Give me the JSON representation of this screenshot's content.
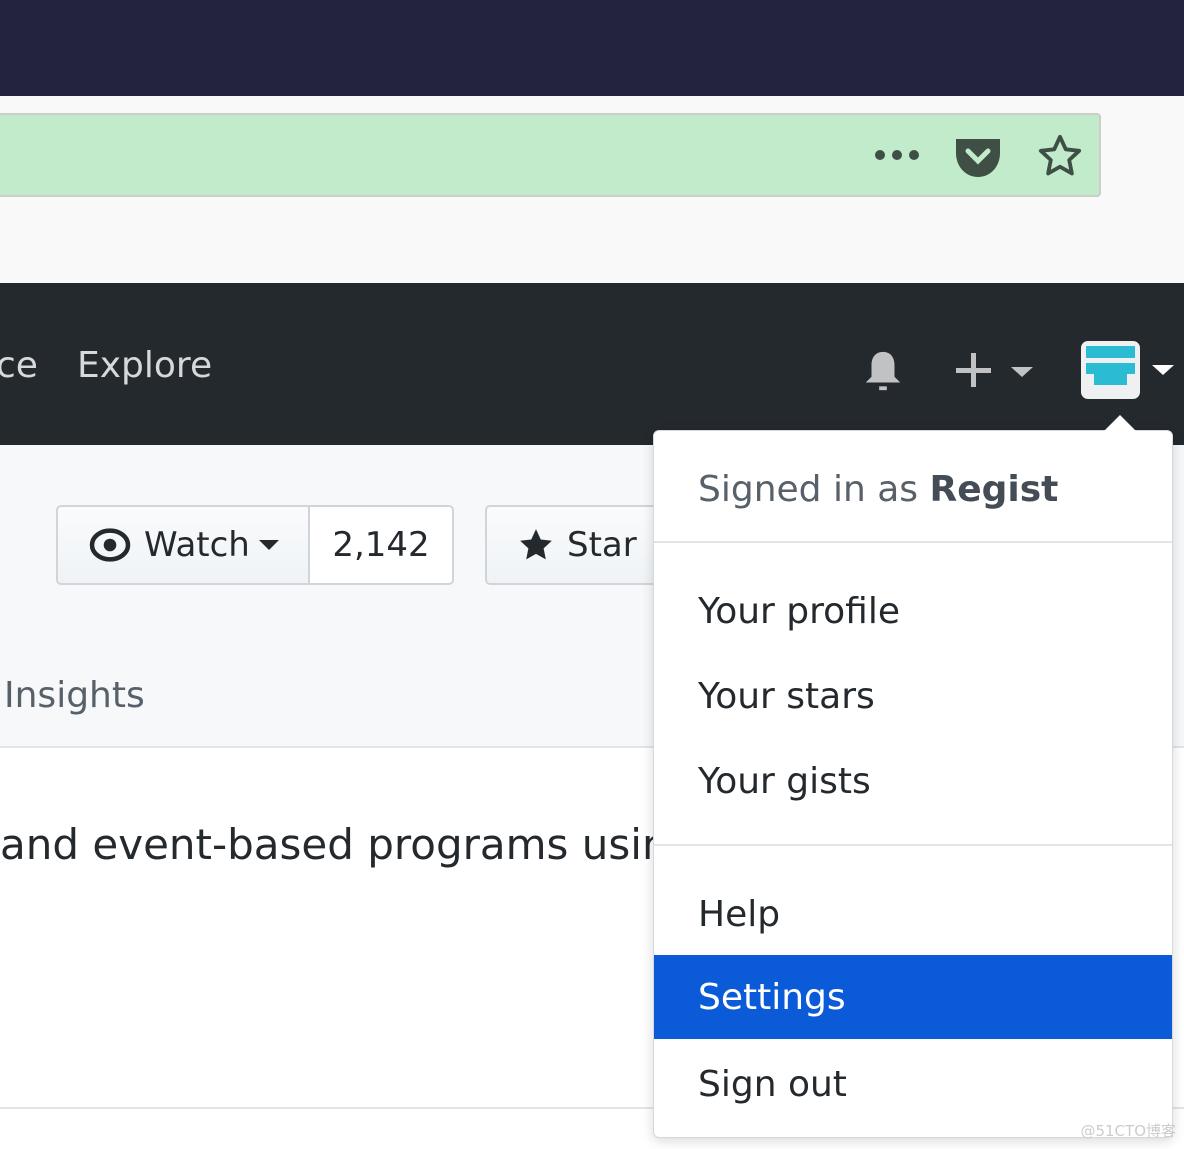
{
  "browser": {
    "more_icon": "ellipsis-icon",
    "pocket_icon": "pocket-icon",
    "bookmark_icon": "star-outline-icon"
  },
  "header": {
    "nav_partial": "ce",
    "explore": "Explore",
    "notifications_icon": "bell-icon",
    "new_icon": "plus-icon",
    "avatar_color": "#2bbcd4"
  },
  "repo": {
    "watch_label": "Watch",
    "watch_count": "2,142",
    "star_label": "Star",
    "insights_tab": "Insights",
    "description": "and event-based programs using"
  },
  "dropdown": {
    "signed_in_prefix": "Signed in as ",
    "username": "Regist",
    "items": [
      "Your profile",
      "Your stars",
      "Your gists",
      "Help",
      "Settings",
      "Sign out"
    ],
    "highlighted": "Settings",
    "highlight_color": "#0b5bd8"
  },
  "watermark": "@51CTO博客"
}
